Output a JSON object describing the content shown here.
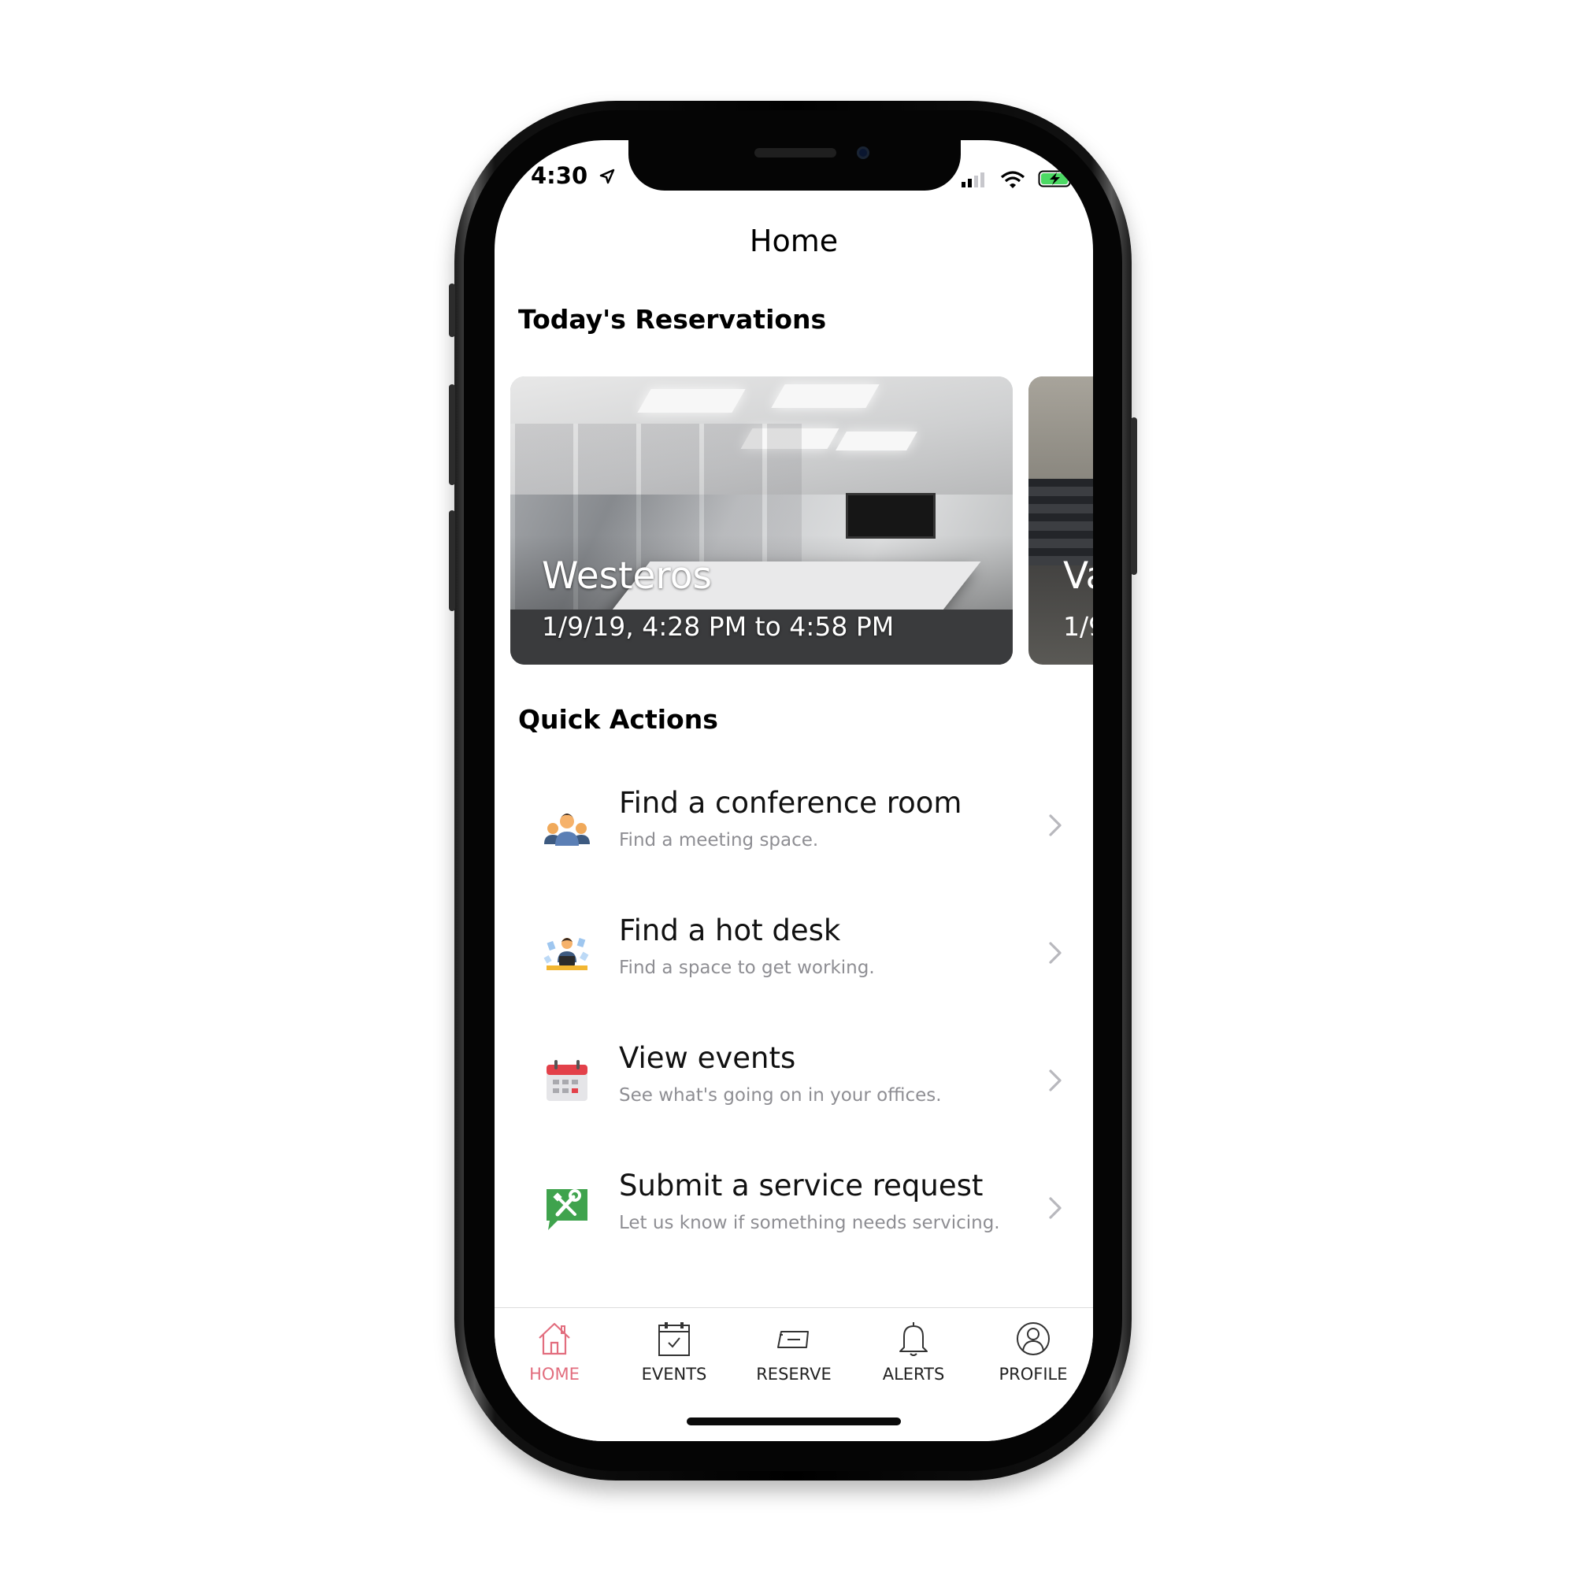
{
  "status_bar": {
    "time": "4:30",
    "location_arrow": "location-arrow-icon",
    "battery": "battery-charging-icon"
  },
  "nav": {
    "title": "Home"
  },
  "reservations": {
    "heading": "Today's Reservations",
    "cards": [
      {
        "title": "Westeros",
        "subtitle": "1/9/19, 4:28 PM to 4:58 PM"
      },
      {
        "title": "Va",
        "subtitle": "1/9"
      }
    ]
  },
  "quick_actions": {
    "heading": "Quick Actions",
    "items": [
      {
        "title": "Find a conference room",
        "subtitle": "Find a meeting space.",
        "icon": "people-group-icon"
      },
      {
        "title": "Find a hot desk",
        "subtitle": "Find a space to get working.",
        "icon": "desk-worker-icon"
      },
      {
        "title": "View events",
        "subtitle": "See what's going on in your offices.",
        "icon": "calendar-icon"
      },
      {
        "title": "Submit a service request",
        "subtitle": "Let us know if something needs servicing.",
        "icon": "tools-bubble-icon"
      }
    ]
  },
  "tabbar": {
    "active_color": "#e26d7e",
    "tabs": [
      {
        "label": "HOME",
        "icon": "home-icon",
        "active": true
      },
      {
        "label": "EVENTS",
        "icon": "calendar-check-icon",
        "active": false
      },
      {
        "label": "RESERVE",
        "icon": "ticket-icon",
        "active": false
      },
      {
        "label": "ALERTS",
        "icon": "bell-icon",
        "active": false
      },
      {
        "label": "PROFILE",
        "icon": "user-circle-icon",
        "active": false
      }
    ]
  }
}
